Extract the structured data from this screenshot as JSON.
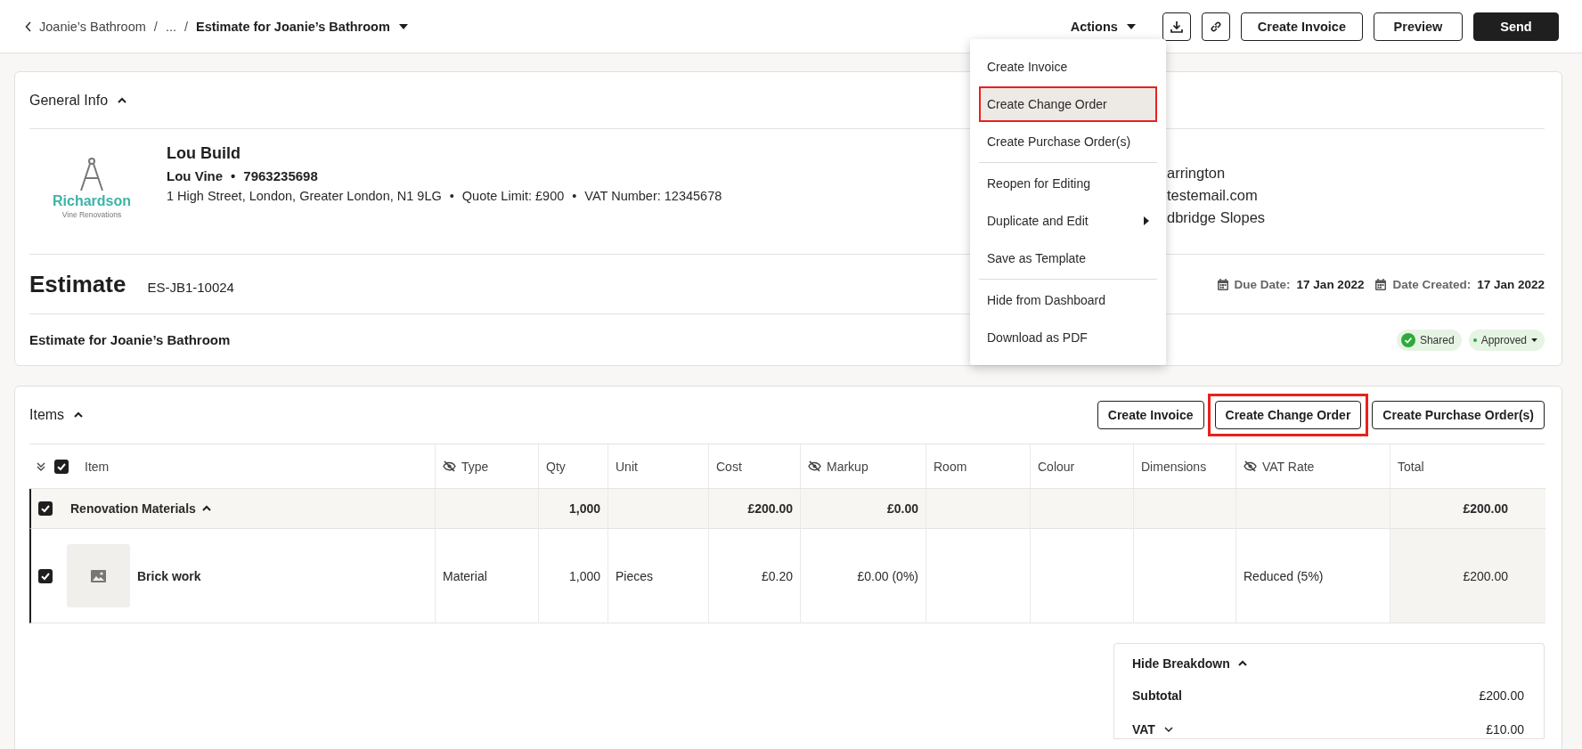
{
  "breadcrumb": {
    "back_label": "Joanie’s Bathroom",
    "separators": [
      "/",
      "/"
    ],
    "middle": "...",
    "current": "Estimate for Joanie’s Bathroom"
  },
  "toolbar": {
    "actions_label": "Actions",
    "buttons": [
      {
        "label": "Create Invoice",
        "kind": "outline"
      },
      {
        "label": "Preview",
        "kind": "outline"
      },
      {
        "label": "Send",
        "kind": "primary"
      }
    ]
  },
  "actions_menu": {
    "groups": [
      {
        "items": [
          {
            "label": "Create Invoice",
            "selected": false,
            "submenu": false
          },
          {
            "label": "Create Change Order",
            "selected": true,
            "submenu": false
          },
          {
            "label": "Create Purchase Order(s)",
            "selected": false,
            "submenu": false
          }
        ]
      },
      {
        "items": [
          {
            "label": "Reopen for Editing",
            "selected": false,
            "submenu": false
          },
          {
            "label": "Duplicate and Edit",
            "selected": false,
            "submenu": true
          },
          {
            "label": "Save as Template",
            "selected": false,
            "submenu": false
          }
        ]
      },
      {
        "items": [
          {
            "label": "Hide from Dashboard",
            "selected": false,
            "submenu": false
          },
          {
            "label": "Download as PDF",
            "selected": false,
            "submenu": false
          }
        ]
      }
    ]
  },
  "general_info": {
    "title": "General Info",
    "expanded": true,
    "logo": {
      "name": "Richardson",
      "tagline": "Vine Renovations"
    },
    "company": "Lou Build",
    "bullets": [
      "•",
      "•",
      "•"
    ],
    "contact_name": "Lou Vine",
    "phone": "7963235698",
    "address": "1 High Street, London, Greater London, N1 9LG",
    "quote_limit": "Quote Limit: £900",
    "vat_number": "VAT Number: 12345678",
    "client_lines": [
      "arrington",
      "testemail.com",
      "dbridge Slopes"
    ]
  },
  "estimate": {
    "title": "Estimate",
    "number": "ES-JB1-10024",
    "due_label": "Due Date:",
    "due": "17 Jan 2022",
    "created_label": "Date Created:",
    "created": "17 Jan 2022",
    "description": "Estimate for Joanie’s Bathroom",
    "badges": [
      {
        "label": "Shared",
        "kind": "check"
      },
      {
        "label": "Approved",
        "kind": "status"
      }
    ]
  },
  "items": {
    "title": "Items",
    "expanded": true,
    "select_all_checked": true,
    "buttons": [
      {
        "label": "Create Invoice",
        "annotated": false
      },
      {
        "label": "Create Change Order",
        "annotated": true
      },
      {
        "label": "Create Purchase Order(s)",
        "annotated": false
      }
    ],
    "columns": [
      {
        "label": "Item",
        "hidden": false
      },
      {
        "label": "Type",
        "hidden": true
      },
      {
        "label": "Qty",
        "hidden": false
      },
      {
        "label": "Unit",
        "hidden": false
      },
      {
        "label": "Cost",
        "hidden": false
      },
      {
        "label": "Markup",
        "hidden": true
      },
      {
        "label": "Room",
        "hidden": false
      },
      {
        "label": "Colour",
        "hidden": false
      },
      {
        "label": "Dimensions",
        "hidden": false
      },
      {
        "label": "VAT Rate",
        "hidden": true
      },
      {
        "label": "Total",
        "hidden": false
      }
    ],
    "groups": [
      {
        "name": "Renovation Materials",
        "checked": true,
        "expanded": true,
        "cells": [
          null,
          "1,000",
          null,
          "£200.00",
          "£0.00",
          null,
          null,
          null,
          null,
          "£200.00"
        ],
        "rows": [
          {
            "name": "Brick work",
            "checked": true,
            "cells": [
              "Material",
              "1,000",
              "Pieces",
              "£0.20",
              "£0.00 (0%)",
              null,
              null,
              null,
              "Reduced (5%)",
              "£200.00"
            ]
          }
        ]
      }
    ]
  },
  "breakdown": {
    "toggle": "Hide Breakdown",
    "expanded": true,
    "lines": [
      {
        "label": "Subtotal",
        "value": "£200.00",
        "expandable": false
      },
      {
        "label": "VAT",
        "value": "£10.00",
        "expandable": true
      }
    ]
  }
}
